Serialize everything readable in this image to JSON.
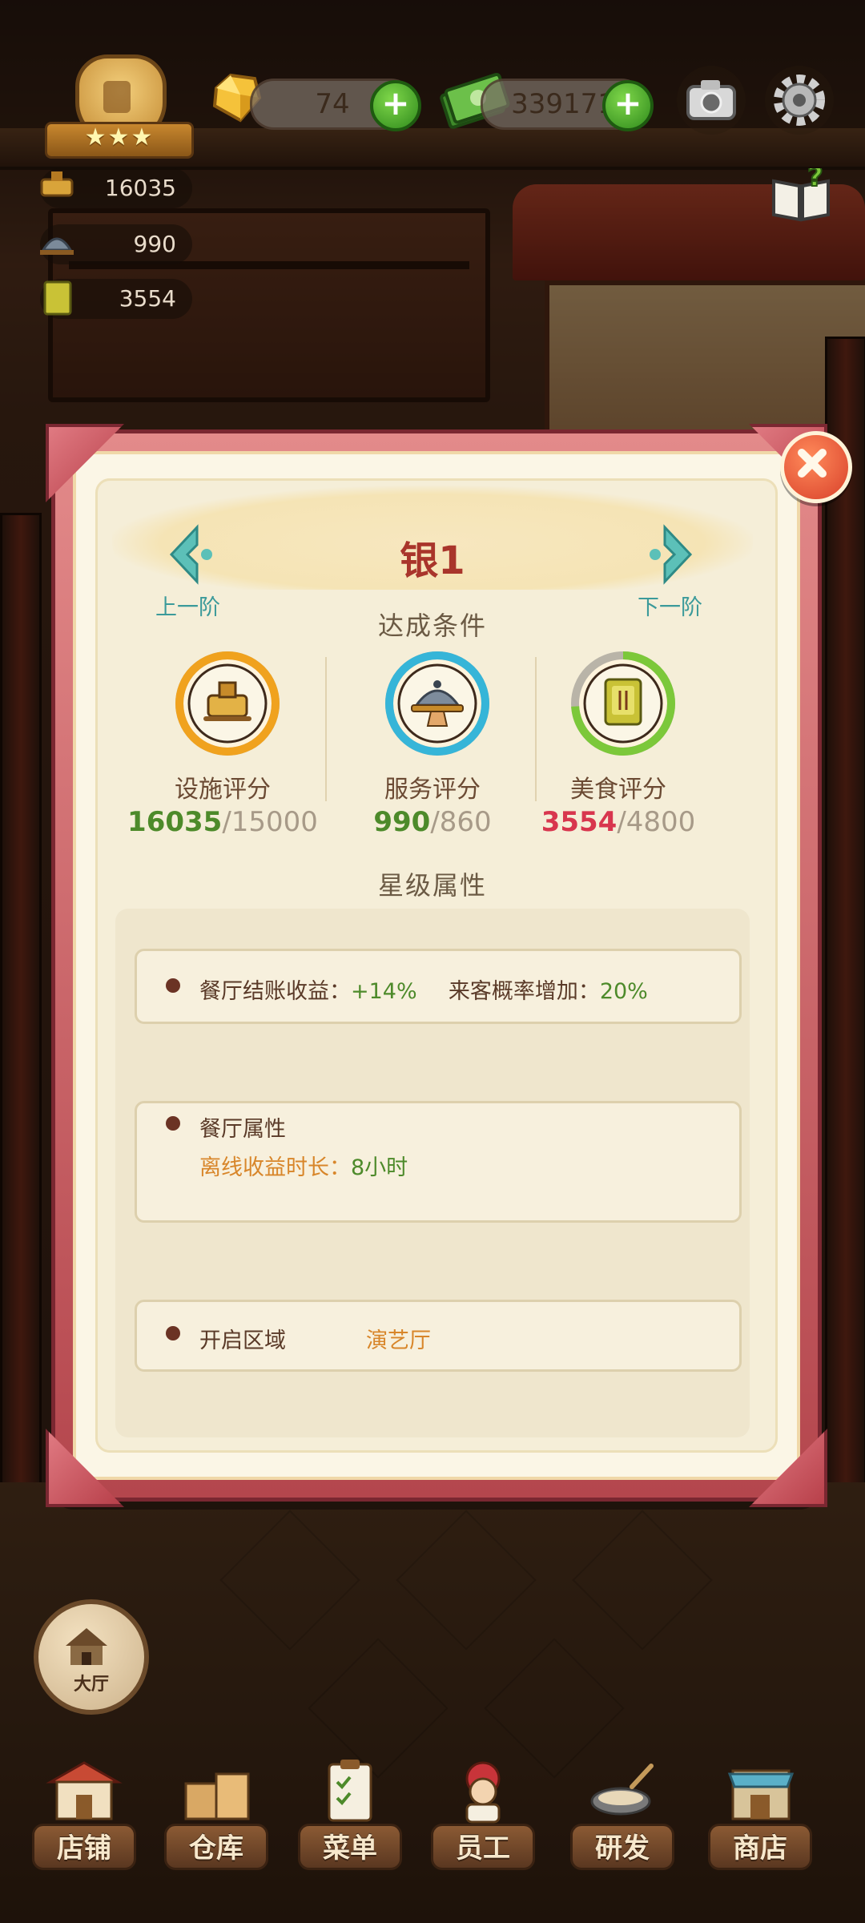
{
  "hud": {
    "gems": "74",
    "cash": "339171",
    "stars": "★★★",
    "stats": {
      "facility": "16035",
      "service": "990",
      "food": "3554"
    }
  },
  "modal": {
    "title": "银1",
    "prev_label": "上一阶",
    "next_label": "下一阶",
    "conditions_heading": "达成条件",
    "metrics": [
      {
        "label": "设施评分",
        "current": "16035",
        "required": "/15000",
        "current_color": "#4d8a2a",
        "ring_color": "#f0a21e",
        "progress": 1.0
      },
      {
        "label": "服务评分",
        "current": "990",
        "required": "/860",
        "current_color": "#4d8a2a",
        "ring_color": "#36b5d8",
        "progress": 1.0
      },
      {
        "label": "美食评分",
        "current": "3554",
        "required": "/4800",
        "current_color": "#d8364e",
        "ring_color": "#7cc83a",
        "progress": 0.74
      }
    ],
    "attributes_heading": "星级属性",
    "card1": {
      "label1": "餐厅结账收益：",
      "value1": "+14%",
      "label2": "来客概率增加：",
      "value2": "20%"
    },
    "card2": {
      "heading": "餐厅属性",
      "label": "离线收益时长：",
      "value": "8小时"
    },
    "card3": {
      "label": "开启区域",
      "value": "演艺厅"
    }
  },
  "hall_button": {
    "label": "大厅"
  },
  "nav": [
    {
      "label": "店铺"
    },
    {
      "label": "仓库"
    },
    {
      "label": "菜单"
    },
    {
      "label": "员工"
    },
    {
      "label": "研发"
    },
    {
      "label": "商店"
    }
  ]
}
